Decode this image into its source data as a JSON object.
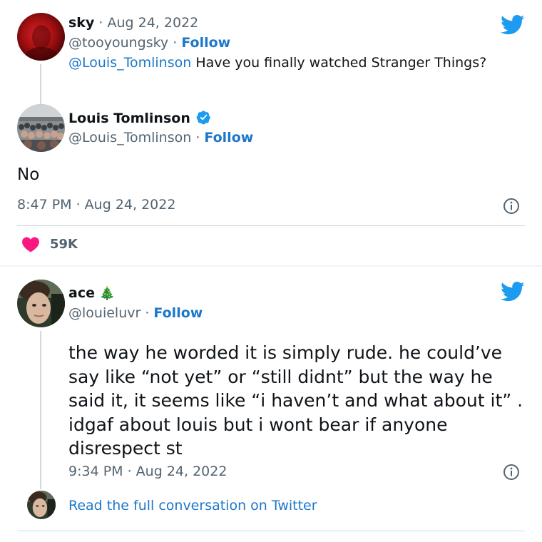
{
  "reply_context": {
    "name": "sky",
    "date": "Aug 24, 2022",
    "handle": "@tooyoungsky",
    "follow_label": "Follow",
    "mention": "@Louis_Tomlinson",
    "text": "Have you finally watched Stranger Things?"
  },
  "main_tweet": {
    "name": "Louis Tomlinson",
    "handle": "@Louis_Tomlinson",
    "follow_label": "Follow",
    "text": "No",
    "timestamp": "8:47 PM · Aug 24, 2022",
    "likes": "59K",
    "verified": true
  },
  "reply_tweet": {
    "name": "ace",
    "emoji": "🎄",
    "handle": "@louieluvr",
    "follow_label": "Follow",
    "text": "the way he worded it is simply rude. he could’ve say like “not yet” or “still didnt” but the way he said it, it seems like “i haven’t and what about it” . idgaf about louis but i wont bear if anyone disrespect st",
    "timestamp": "9:34 PM · Aug 24, 2022",
    "read_more": "Read the full conversation on Twitter"
  },
  "icons": {
    "brand": "twitter-bird-icon",
    "info": "info-icon",
    "like": "heart-icon",
    "verified": "verified-badge-icon"
  },
  "colors": {
    "link": "#1d77c9",
    "twitter_blue": "#1d9bf0",
    "heart": "#f91880",
    "secondary_text": "#536471"
  }
}
